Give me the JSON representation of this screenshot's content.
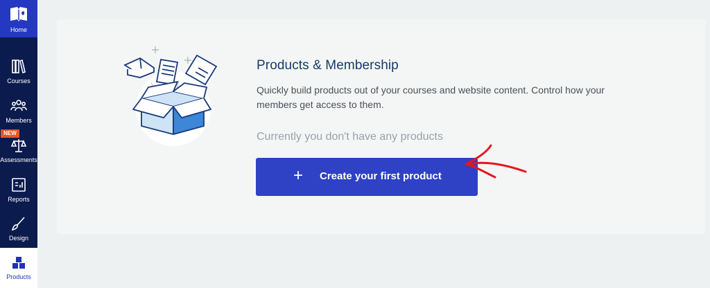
{
  "sidebar": {
    "home_label": "Home",
    "new_badge": "NEW",
    "items": [
      {
        "label": "Courses",
        "icon": "books-icon"
      },
      {
        "label": "Members",
        "icon": "people-icon"
      },
      {
        "label": "Assessments",
        "icon": "scales-icon"
      },
      {
        "label": "Reports",
        "icon": "report-icon"
      },
      {
        "label": "Design",
        "icon": "brush-icon"
      },
      {
        "label": "Products",
        "icon": "products-icon",
        "active": true
      }
    ]
  },
  "main": {
    "title": "Products & Membership",
    "description": "Quickly build products out of your courses and website content. Control how your members get access to them.",
    "empty_state": "Currently you don't have any products",
    "create_button": {
      "icon": "+",
      "label": "Create your first product"
    }
  },
  "colors": {
    "sidebar_bg": "#0c1b4d",
    "accent": "#2f41c4",
    "title": "#143a6b",
    "annotation_arrow": "#e8141e",
    "new_badge": "#e9541e"
  }
}
